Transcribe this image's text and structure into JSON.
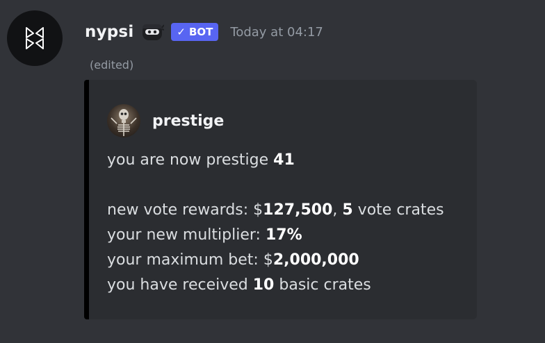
{
  "message": {
    "username": "nypsi",
    "bot_tag": "BOT",
    "timestamp": "Today at 04:17",
    "edited": "(edited)",
    "role_icon": "ninja-robot-icon",
    "avatar_icon": "nypsi-logo-icon"
  },
  "embed": {
    "color": "#000000",
    "author": {
      "name": "prestige",
      "icon": "skeleton-avatar-icon"
    },
    "description": {
      "line1": {
        "text": "you are now prestige ",
        "value": "41"
      },
      "line2": {
        "prefix": "new vote rewards: $",
        "money": "127,500",
        "sep": ", ",
        "crates": "5",
        "suffix": " vote crates"
      },
      "line3": {
        "prefix": "your new multiplier: ",
        "value": "17%"
      },
      "line4": {
        "prefix": "your maximum bet: $",
        "value": "2,000,000"
      },
      "line5": {
        "prefix": "you have received ",
        "value": "10",
        "suffix": " basic crates"
      }
    }
  },
  "colors": {
    "background": "#313338",
    "embed_background": "#2b2d31",
    "bot_tag": "#5865f2",
    "muted_text": "#949ba4"
  }
}
